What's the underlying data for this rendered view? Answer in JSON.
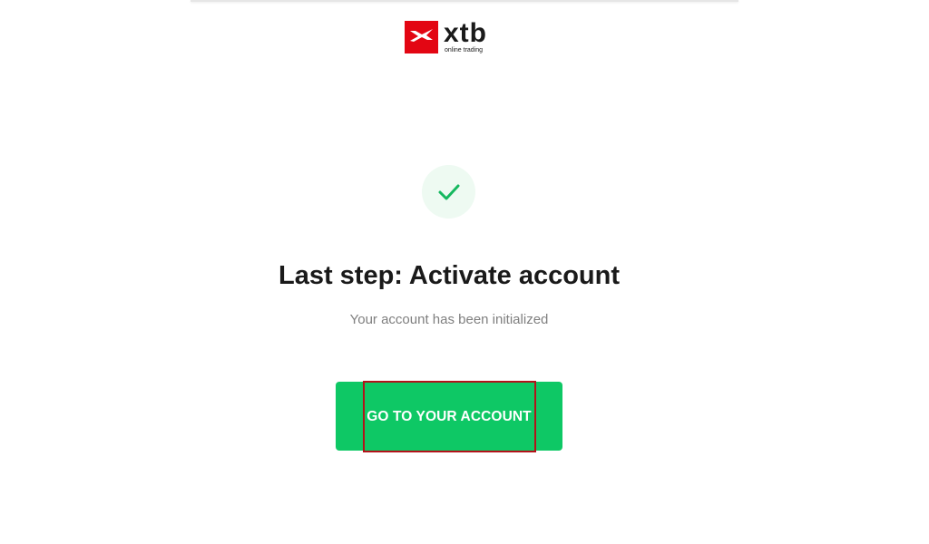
{
  "brand": {
    "name": "xtb",
    "tagline": "online trading",
    "logo_color": "#e30613"
  },
  "status_icon": "checkmark-icon",
  "main": {
    "title": "Last step: Activate account",
    "subtitle": "Your account has been initialized",
    "cta_label": "GO TO YOUR ACCOUNT"
  },
  "colors": {
    "accent_green": "#0ec865",
    "check_bg": "#eefaf2",
    "highlight_annotation": "#b3121a"
  }
}
